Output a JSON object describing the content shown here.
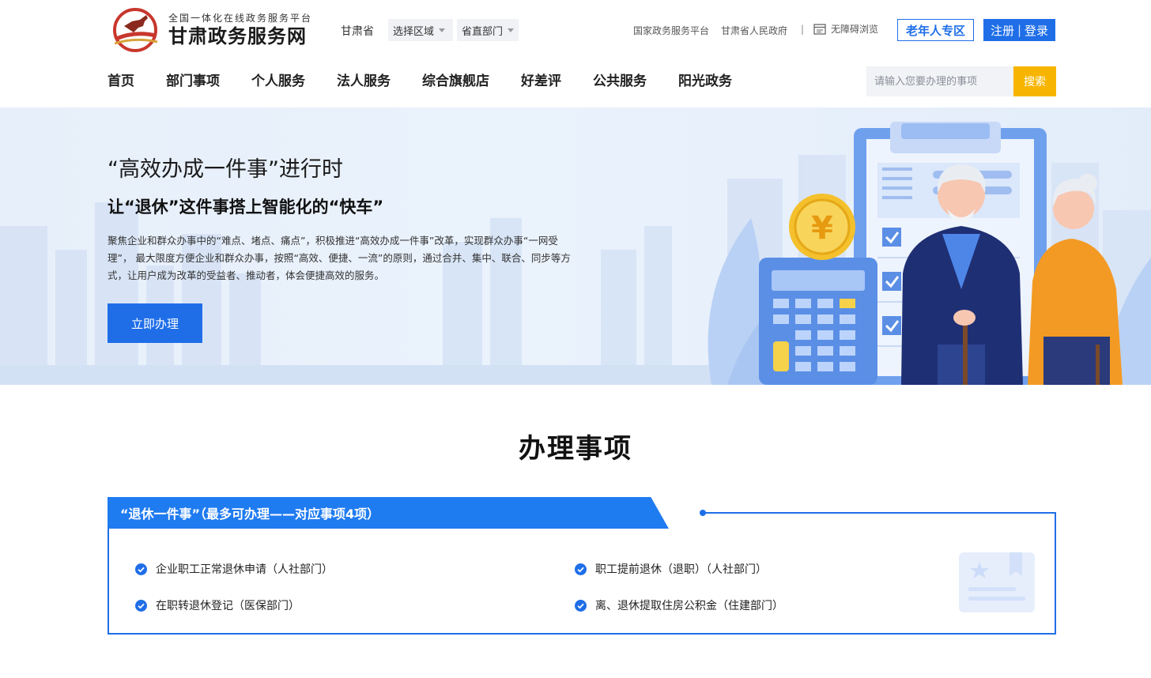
{
  "header": {
    "logo_sub": "全国一体化在线政务服务平台",
    "logo_main": "甘肃政务服务网",
    "province": "甘肃省",
    "region_select": "选择区域",
    "dept_select": "省直部门",
    "link_national": "国家政务服务平台",
    "link_provincial_gov": "甘肃省人民政府",
    "separator": "|",
    "accessible": "无障碍浏览",
    "elder_zone": "老年人专区",
    "register": "注册",
    "login_sep": "|",
    "login": "登录"
  },
  "nav": {
    "items": [
      "首页",
      "部门事项",
      "个人服务",
      "法人服务",
      "综合旗舰店",
      "好差评",
      "公共服务",
      "阳光政务"
    ],
    "search_placeholder": "请输入您要办理的事项",
    "search_button": "搜索"
  },
  "banner": {
    "title": "“高效办成一件事”进行时",
    "subtitle": "让“退休”这件事搭上智能化的“快车”",
    "description": "聚焦企业和群众办事中的“难点、堵点、痛点”，积极推进“高效办成一件事”改革，实现群众办事“一网受理”， 最大限度方便企业和群众办事，按照“高效、便捷、一流”的原则，通过合并、集中、联合、同步等方式，让用户成为改革的受益者、推动者，体会便捷高效的服务。",
    "button": "立即办理",
    "coin_symbol": "¥"
  },
  "section": {
    "title": "办理事项",
    "tab_label": "“退休一件事”（最多可办理——对应事项4项）",
    "items": [
      "企业职工正常退休申请（人社部门）",
      "职工提前退休（退职）（人社部门）",
      "在职转退休登记（医保部门）",
      "离、退休提取住房公积金（住建部门）"
    ]
  },
  "colors": {
    "primary": "#1f6ee8",
    "accent": "#f7b500",
    "banner_bg": "#e7effa"
  },
  "icons": {
    "logo": "horse-logo-icon",
    "accessible": "accessibility-icon",
    "check": "check-circle-icon",
    "card_deco": "certificate-icon"
  }
}
